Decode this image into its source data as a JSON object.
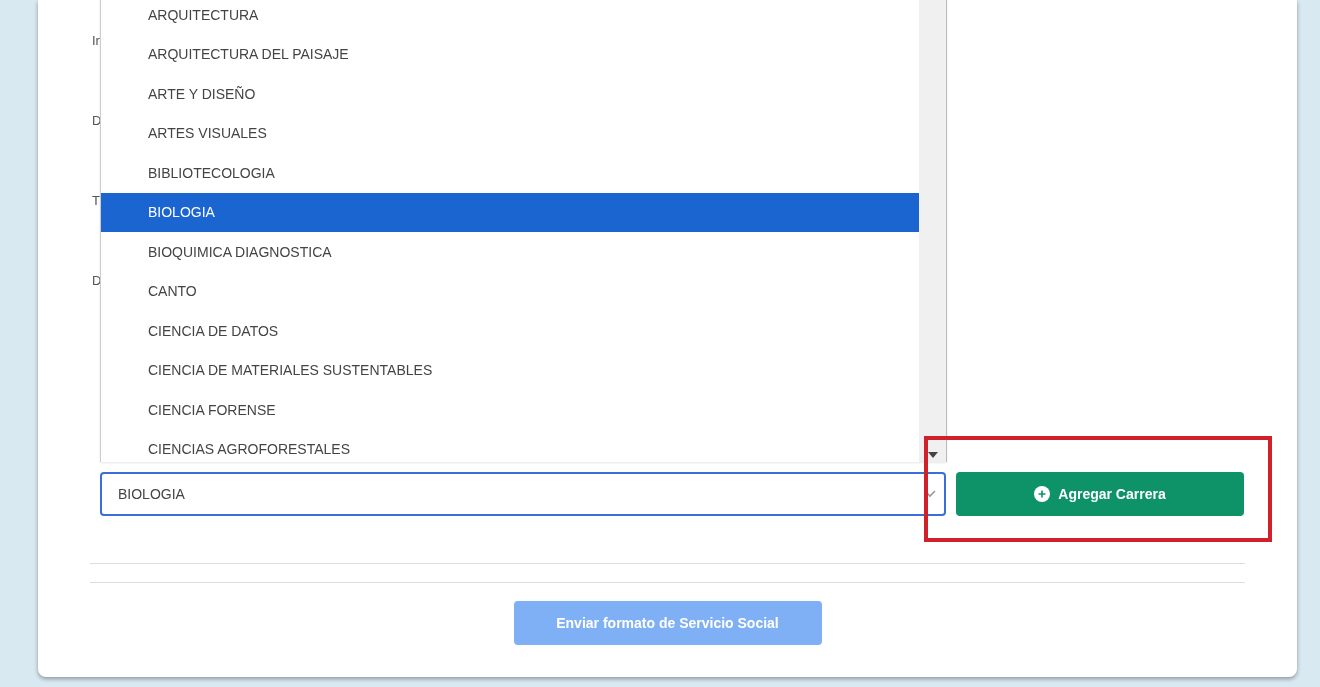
{
  "form": {
    "labels": [
      "Ir",
      "D",
      "T",
      "D"
    ],
    "career_dropdown": {
      "options": [
        {
          "label": "ARQUITECTURA",
          "selected": false
        },
        {
          "label": "ARQUITECTURA DEL PAISAJE",
          "selected": false
        },
        {
          "label": "ARTE Y DISEÑO",
          "selected": false
        },
        {
          "label": "ARTES VISUALES",
          "selected": false
        },
        {
          "label": "BIBLIOTECOLOGIA",
          "selected": false
        },
        {
          "label": "BIOLOGIA",
          "selected": true
        },
        {
          "label": "BIOQUIMICA DIAGNOSTICA",
          "selected": false
        },
        {
          "label": "CANTO",
          "selected": false
        },
        {
          "label": "CIENCIA DE DATOS",
          "selected": false
        },
        {
          "label": "CIENCIA DE MATERIALES SUSTENTABLES",
          "selected": false
        },
        {
          "label": "CIENCIA FORENSE",
          "selected": false
        },
        {
          "label": "CIENCIAS AGROFORESTALES",
          "selected": false
        }
      ]
    },
    "career_select": {
      "value": "BIOLOGIA"
    },
    "add_button": {
      "label": "Agregar Carrera"
    },
    "annotation": {
      "kind": "rectangle"
    }
  },
  "submit_button": {
    "label": "Enviar formato de Servicio Social",
    "disabled": true
  }
}
